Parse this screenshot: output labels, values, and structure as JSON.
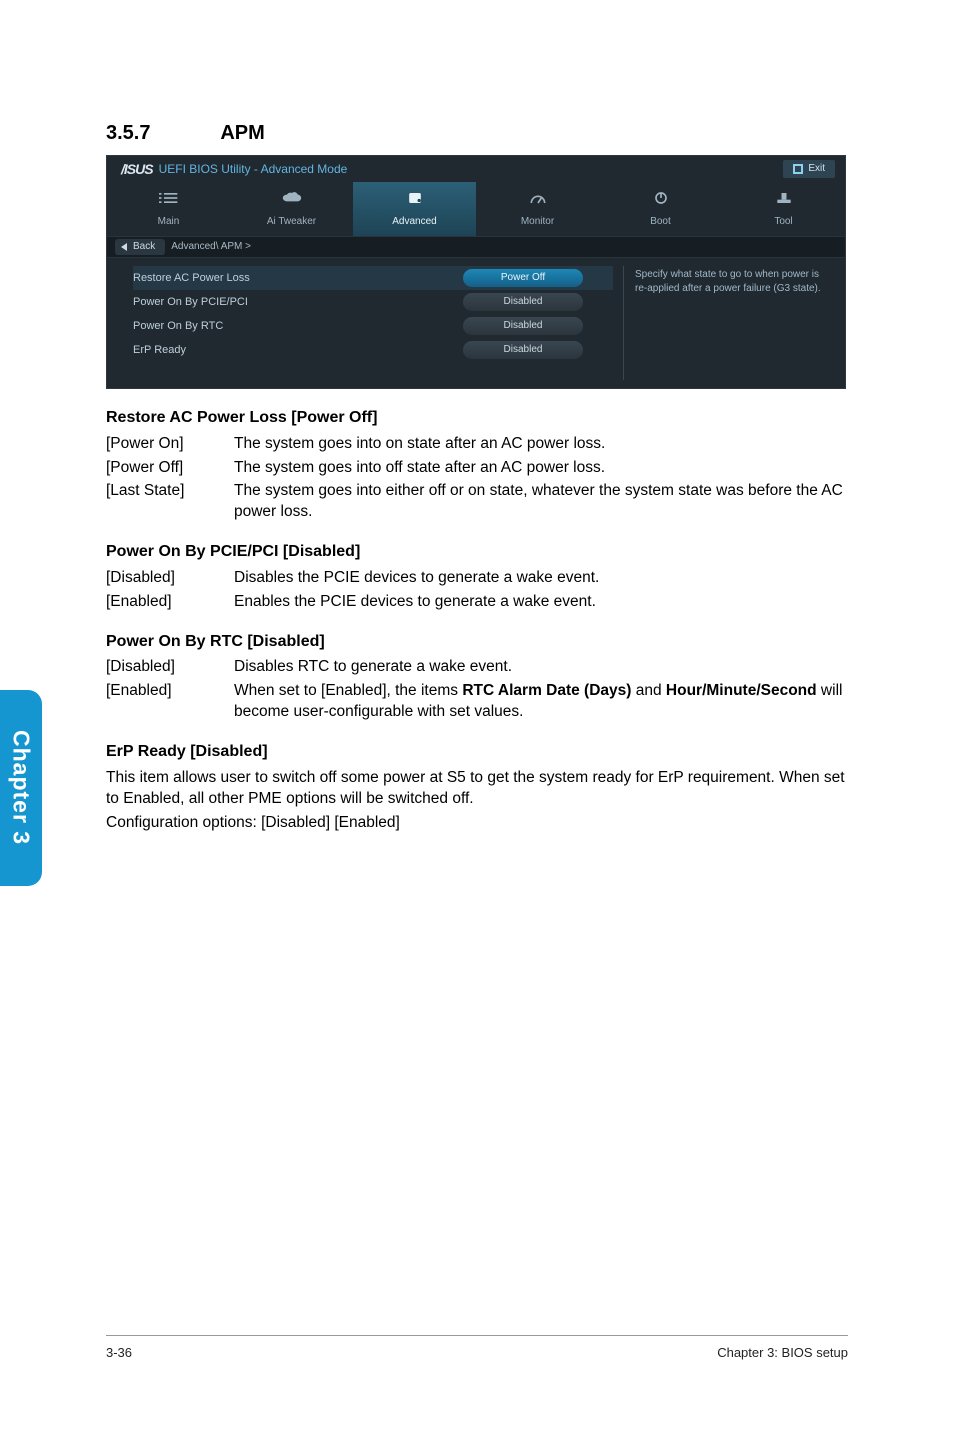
{
  "section": {
    "number": "3.5.7",
    "title": "APM"
  },
  "bios": {
    "logo": "/ISUS",
    "titlebar": "UEFI BIOS Utility - Advanced Mode",
    "exit": "Exit",
    "tabs": {
      "main": "Main",
      "aitweaker": "Ai Tweaker",
      "advanced": "Advanced",
      "monitor": "Monitor",
      "boot": "Boot",
      "tool": "Tool"
    },
    "back": "Back",
    "breadcrumb": "Advanced\\ APM >",
    "rows": {
      "restore": {
        "label": "Restore AC Power Loss",
        "value": "Power Off"
      },
      "pcie": {
        "label": "Power On By PCIE/PCI",
        "value": "Disabled"
      },
      "rtc": {
        "label": "Power On By RTC",
        "value": "Disabled"
      },
      "erp": {
        "label": "ErP Ready",
        "value": "Disabled"
      }
    },
    "help": "Specify what state to go to when power is re-applied after a power failure (G3 state)."
  },
  "sections": {
    "restore": {
      "heading": "Restore AC Power Loss [Power Off]",
      "items": [
        {
          "k": "[Power On]",
          "v": "The system goes into on state after an AC power loss."
        },
        {
          "k": "[Power Off]",
          "v": "The system goes into off state after an AC power loss."
        },
        {
          "k": "[Last State]",
          "v": "The system goes into either off or on state, whatever the system state was before the AC power loss."
        }
      ]
    },
    "pcie": {
      "heading": "Power On By PCIE/PCI [Disabled]",
      "items": [
        {
          "k": "[Disabled]",
          "v": "Disables the PCIE devices to generate a wake event."
        },
        {
          "k": "[Enabled]",
          "v": "Enables the PCIE devices to generate a wake event."
        }
      ]
    },
    "rtc": {
      "heading": "Power On By RTC [Disabled]",
      "items": [
        {
          "k": "[Disabled]",
          "v": "Disables RTC to generate a wake event."
        }
      ],
      "enabled_key": "[Enabled]",
      "enabled_prefix": "When set to [Enabled], the items ",
      "enabled_bold1": "RTC Alarm Date (Days)",
      "enabled_mid": " and ",
      "enabled_bold2": "Hour/Minute/Second",
      "enabled_suffix": " will become user-configurable with set values."
    },
    "erp": {
      "heading": "ErP Ready [Disabled]",
      "p1": "This item allows user to switch off some power at S5 to get the system ready for ErP requirement. When set to Enabled, all other PME options will be switched off.",
      "p2": "Configuration options: [Disabled] [Enabled]"
    }
  },
  "sidetab": "Chapter 3",
  "footer": {
    "left": "3-36",
    "right": "Chapter 3: BIOS setup"
  }
}
